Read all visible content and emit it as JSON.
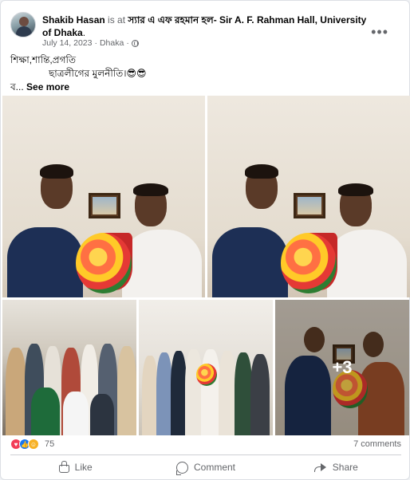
{
  "post": {
    "author": "Shakib Hasan",
    "at_text": "is at",
    "place": "স্যার এ এফ রহমান হল- Sir A. F. Rahman Hall, University of Dhaka",
    "place_suffix": ".",
    "date": "July 14, 2023",
    "separator": "·",
    "location": "Dhaka",
    "separator2": "·",
    "more_icon": "•••",
    "text_line1": "শিক্ষা,শান্তি,প্রগতি",
    "text_line2": "ছাত্রলীগের মুলনীতি।😎😎",
    "text_line3_prefix": "ব...",
    "see_more": "See more",
    "extra_photos": "+3"
  },
  "stats": {
    "reaction_count": "75",
    "comments": "7 comments"
  },
  "actions": {
    "like": "Like",
    "comment": "Comment",
    "share": "Share"
  },
  "icons": {
    "avatar": "profile-avatar",
    "privacy": "globe-icon",
    "more": "ellipsis-icon"
  },
  "colors": {
    "secondary_text": "#65676b",
    "like_blue": "#1877f2",
    "love_red": "#f33e58",
    "care_yellow": "#f7b125"
  }
}
